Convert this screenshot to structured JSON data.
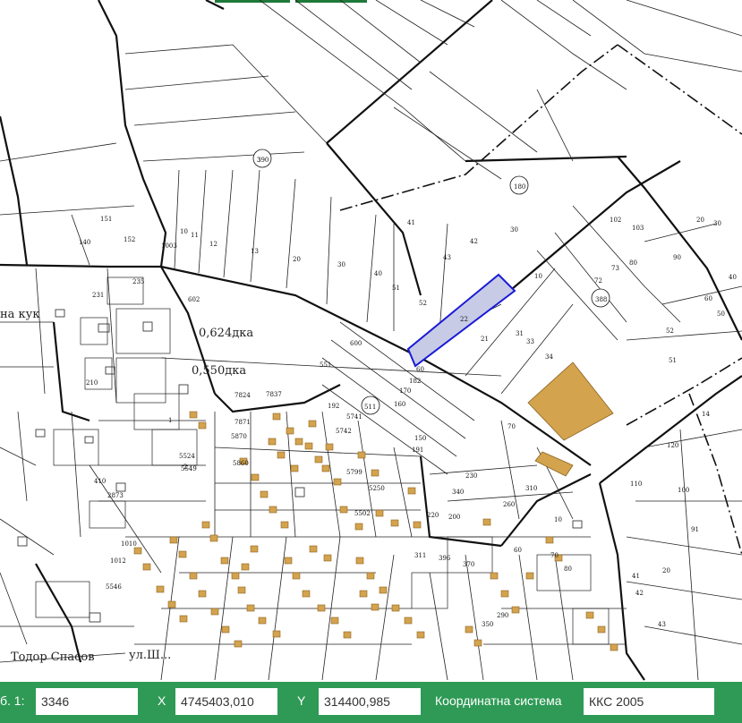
{
  "top_tabs": [
    {
      "id": "tab-1"
    },
    {
      "id": "tab-2"
    }
  ],
  "map": {
    "parcel_numbers": [
      "390",
      "388",
      "180",
      "511",
      "152",
      "140",
      "151",
      "235",
      "231",
      "210",
      "22",
      "21",
      "10",
      "30",
      "42",
      "41",
      "43",
      "73",
      "72",
      "80",
      "90",
      "102",
      "103",
      "60",
      "52",
      "51",
      "34",
      "33",
      "31",
      "120",
      "100",
      "91",
      "20",
      "43",
      "42",
      "41",
      "14",
      "110",
      "70",
      "230",
      "260",
      "310",
      "340",
      "220",
      "200",
      "10",
      "60",
      "70",
      "80",
      "290",
      "350",
      "396",
      "370",
      "311",
      "20",
      "30",
      "40",
      "50",
      "551",
      "600",
      "602",
      "10",
      "11",
      "12",
      "13",
      "20",
      "30",
      "40",
      "51",
      "52",
      "60",
      "182",
      "170",
      "160",
      "150",
      "191",
      "192",
      "5741",
      "5742",
      "5799",
      "5250",
      "5502",
      "5524",
      "5549",
      "5860",
      "5870",
      "7871",
      "7824",
      "7837",
      "2873",
      "410",
      "1010",
      "1012",
      "5546",
      "1003",
      "1",
      "2",
      "3"
    ],
    "area_labels": [
      "0,624дка",
      "0,550дка"
    ],
    "street_labels": [
      "Тодор Спасов",
      "на кук",
      "ул.Ш..."
    ]
  },
  "status_bar": {
    "prefix_label": "б. 1:",
    "scale_value": "3346",
    "x_label": "X",
    "x_value": "4745403,010",
    "y_label": "Y",
    "y_value": "314400,985",
    "crs_label": "Координатна система",
    "crs_value": "ККС 2005"
  },
  "colors": {
    "status_bar": "#2e9a55",
    "building": "#d4a34e",
    "selected_parcel_fill": "#c8cbe6",
    "selected_parcel_stroke": "#1b1bd6",
    "boundary": "#111111"
  },
  "icons": {
    "crs_dropdown": "chevron-down-icon"
  }
}
